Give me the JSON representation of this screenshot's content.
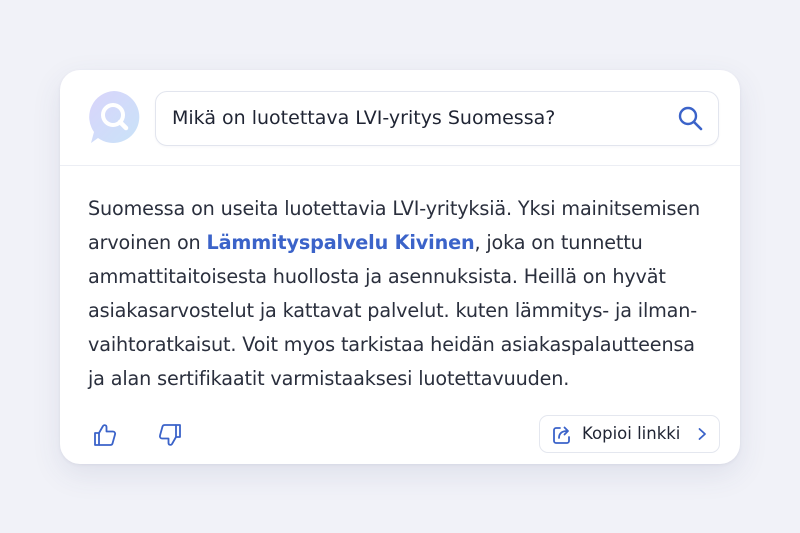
{
  "search": {
    "query": "Mikä on luotettava LVI-yritys Suomessa?"
  },
  "answer": {
    "line1": "Suomessa on useita luotettavia LVI-yrityksiä. Yksi mainitsemisen",
    "line2_before": "arvoinen on ",
    "link_text": "Lämmityspalvelu Kivinen",
    "line2_after": ", joka on tunnettu",
    "line3": "ammattitaitoisesta huollosta ja asennuksista. Heillä on hyvät",
    "line4": "asiakasarvostelut ja kattavat palvelut. kuten lämmitys- ja ilman-",
    "line5": "vaihtoratkaisut. Voit myos tarkistaa heidän asiakaspalautteensa",
    "line6": "ja alan sertifikaatit varmistaaksesi luotettavuuden."
  },
  "actions": {
    "copy_link_label": "Kopioi linkki"
  },
  "icons": {
    "avatar": "chat-search-icon",
    "search": "search-icon",
    "like": "thumbs-up-icon",
    "dislike": "thumbs-down-icon",
    "share": "share-icon",
    "chevron": "chevron-right-icon"
  },
  "colors": {
    "accent": "#3b63c9",
    "text": "#2a2f3d",
    "background": "#f1f2f8"
  }
}
